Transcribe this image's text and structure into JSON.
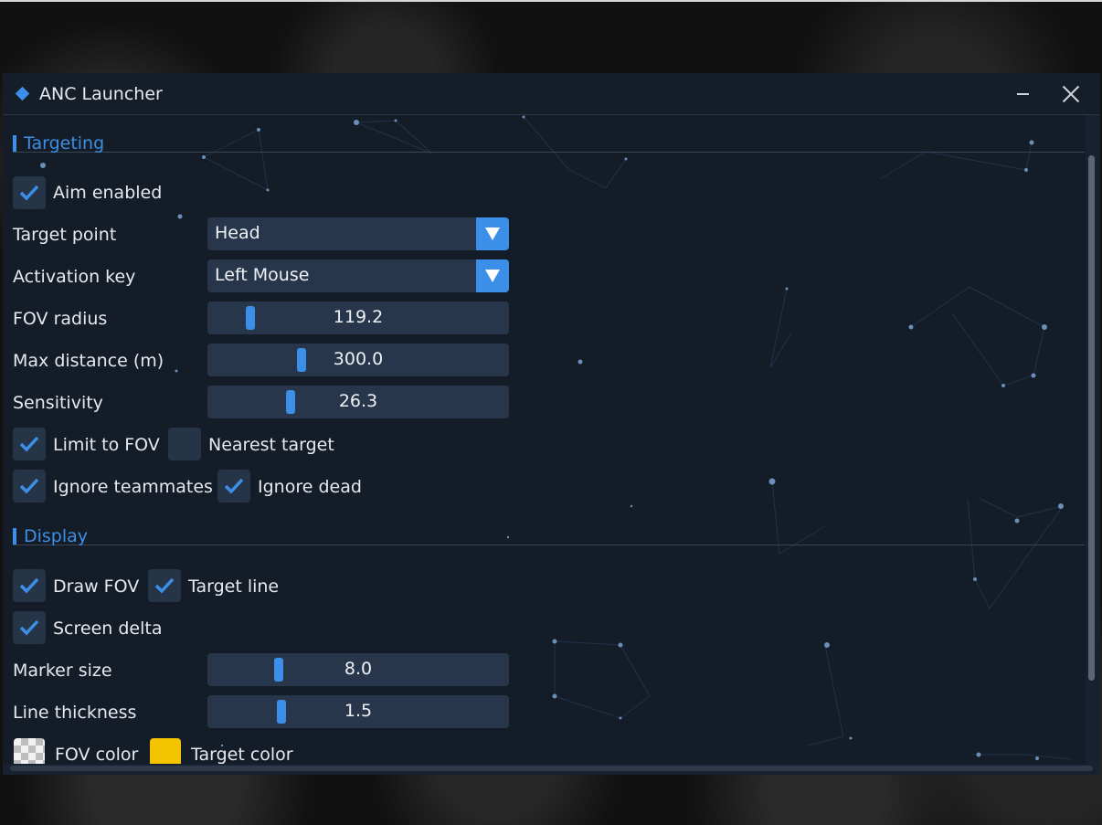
{
  "window": {
    "title": "ANC Launcher",
    "accent": "#3b8fe8",
    "icons": {
      "app": "diamond-icon",
      "minimize": "minimize-icon",
      "close": "close-icon"
    }
  },
  "targeting": {
    "header": "Targeting",
    "aim_enabled": {
      "label": "Aim enabled",
      "checked": true
    },
    "target_point": {
      "label": "Target point",
      "value": "Head"
    },
    "activation_key": {
      "label": "Activation key",
      "value": "Left Mouse"
    },
    "fov_radius": {
      "label": "FOV radius",
      "value": "119.2",
      "fraction": 0.12
    },
    "max_distance": {
      "label": "Max distance (m)",
      "value": "300.0",
      "fraction": 0.3
    },
    "sensitivity": {
      "label": "Sensitivity",
      "value": "26.3",
      "fraction": 0.26
    },
    "limit_to_fov": {
      "label": "Limit to FOV",
      "checked": true
    },
    "nearest_target": {
      "label": "Nearest target",
      "checked": false
    },
    "ignore_teammates": {
      "label": "Ignore teammates",
      "checked": true
    },
    "ignore_dead": {
      "label": "Ignore dead",
      "checked": true
    }
  },
  "display": {
    "header": "Display",
    "draw_fov": {
      "label": "Draw FOV",
      "checked": true
    },
    "target_line": {
      "label": "Target line",
      "checked": true
    },
    "screen_delta": {
      "label": "Screen delta",
      "checked": true
    },
    "marker_size": {
      "label": "Marker size",
      "value": "8.0",
      "fraction": 0.22
    },
    "line_thickness": {
      "label": "Line thickness",
      "value": "1.5",
      "fraction": 0.23
    },
    "fov_color": {
      "label": "FOV color",
      "color": "#f2f2f2"
    },
    "target_color": {
      "label": "Target color",
      "color": "#f5c400"
    }
  }
}
